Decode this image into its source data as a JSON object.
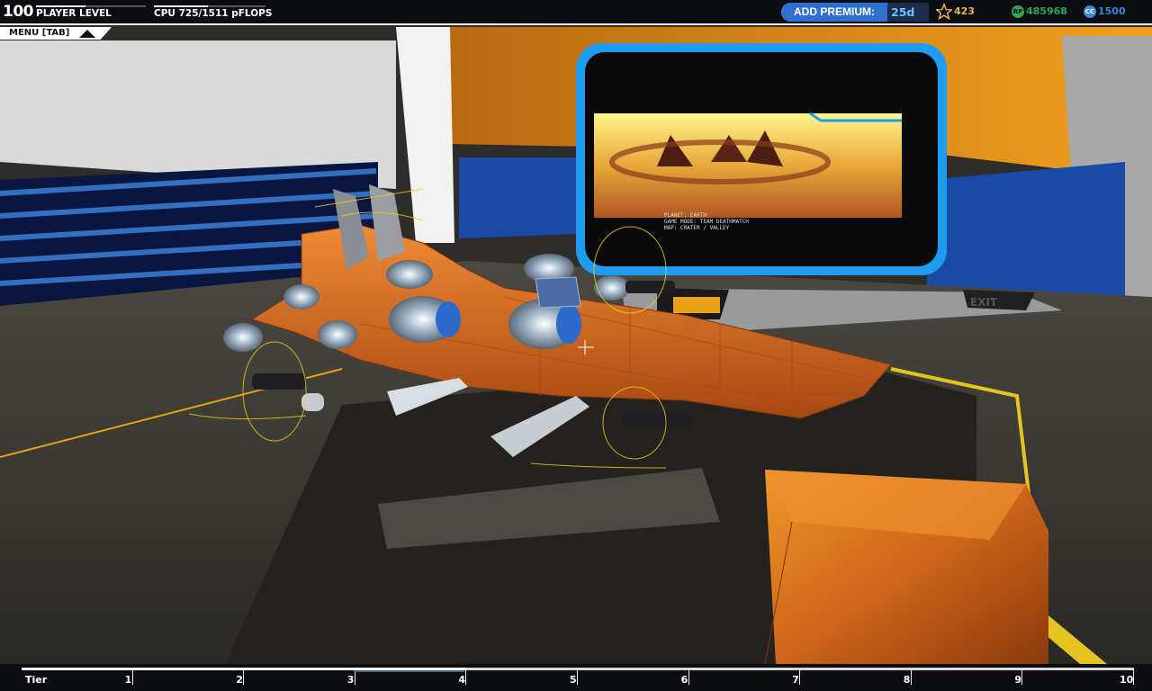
{
  "hud": {
    "player_level": "100",
    "player_level_label": "PLAYER LEVEL",
    "cpu_text": "CPU 725/1511 pFLOPS",
    "cpu_fraction": 0.48,
    "level_progress_fraction": 0.45,
    "premium_label": "ADD PREMIUM:",
    "premium_days": "25d",
    "stars": "423",
    "rp_icon": "RP",
    "robot_points": "485968",
    "cc_icon": "CC",
    "cosmetic_credits": "1500",
    "menu_label": "MENU [TAB]"
  },
  "screen": {
    "info_lines": [
      "PLANET: EARTH",
      "GAME MODE: TEAM DEATHMATCH",
      "MAP: CRATER / VALLEY"
    ]
  },
  "exit_sign": "EXIT",
  "tier_bar": {
    "label": "Tier",
    "tiers": [
      "1",
      "2",
      "3",
      "4",
      "5",
      "6",
      "7",
      "8",
      "9",
      "10"
    ],
    "progress_fraction": 0.4
  },
  "colors": {
    "accent_blue": "#2e6fd0",
    "premium_text": "#6ec2ff",
    "star": "#e8b84a",
    "rp": "#2fa55b",
    "cc": "#3d87d8",
    "robot_orange": "#e0762a"
  }
}
